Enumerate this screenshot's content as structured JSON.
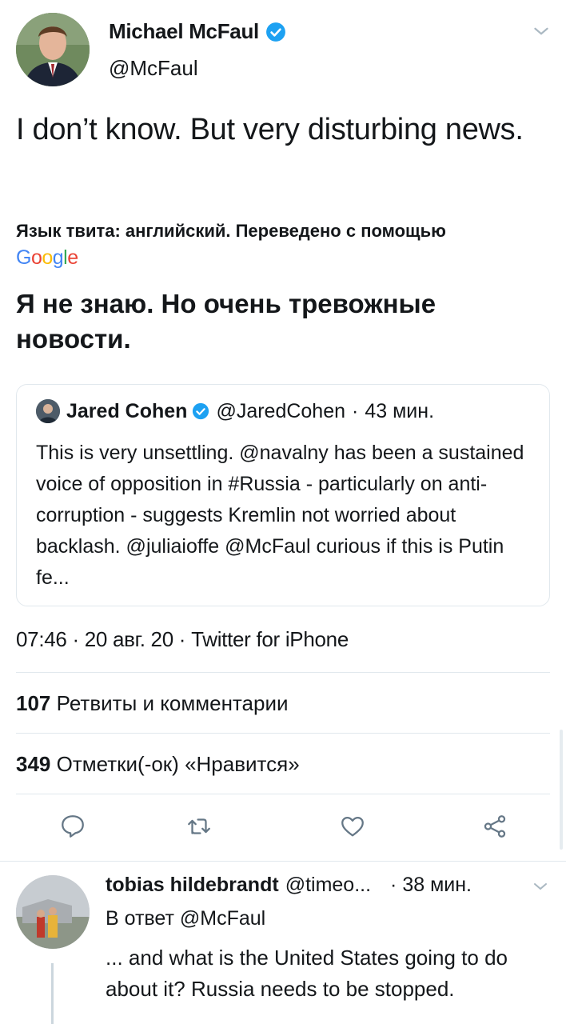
{
  "tweet": {
    "author_name": "Michael McFaul",
    "author_handle": "@McFaul",
    "text": "I don’t know. But very disturbing news.",
    "translation_note": "Язык твита: английский. Переведено с помощью",
    "translation_provider": "Google",
    "translated_text": "Я не знаю. Но очень тревожные новости.",
    "timestamp_line": "07:46 · 20 авг. 20 · Twitter for iPhone"
  },
  "quoted_tweet": {
    "author_name": "Jared Cohen",
    "author_handle": "@JaredCohen",
    "separator": "·",
    "time": "43 мин.",
    "text": "This is very unsettling. @navalny has been a sustained voice of opposition in #Russia - particularly on anti-corruption - suggests Kremlin not worried about backlash. @juliaioffe @McFaul curious if this is Putin fe..."
  },
  "stats": {
    "retweets_count": "107",
    "retweets_label": "Ретвиты и комментарии",
    "likes_count": "349",
    "likes_label": "Отметки(-ок) «Нравится»"
  },
  "actions": [
    "reply-icon",
    "retweet-icon",
    "like-icon",
    "share-icon"
  ],
  "reply": {
    "author_name": "tobias hildebrandt",
    "author_handle": "@timeo...",
    "time": "· 38 мин.",
    "reply_to": "В ответ @McFaul",
    "text": "... and what is the United States going to do about it? Russia needs to be stopped."
  },
  "colors": {
    "verified": "#1da1f2",
    "text": "#14171a",
    "icon": "#657786",
    "divider": "#e1e8ed"
  }
}
